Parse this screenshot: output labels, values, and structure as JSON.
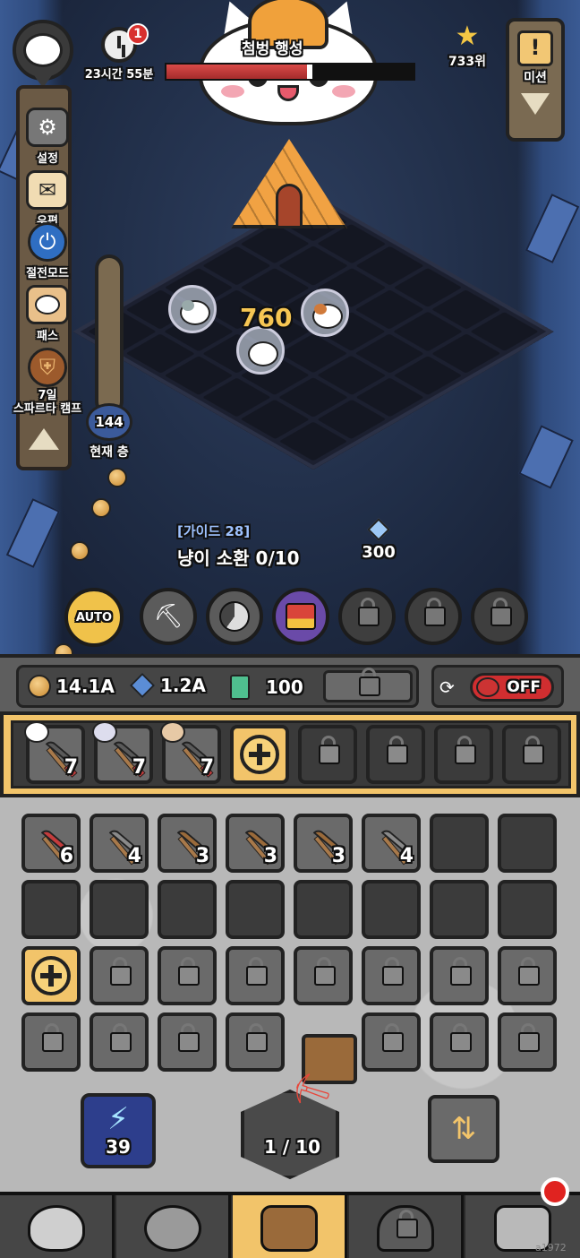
{
  "boss": {
    "name": "첨벙 행성",
    "hp_fraction": 0.59
  },
  "timer": {
    "badge_count": "1",
    "label": "23시간 55분"
  },
  "rank": {
    "label": "733위"
  },
  "mission": {
    "label": "미션",
    "icon": "!"
  },
  "sidebar": {
    "items": [
      {
        "label": "설정",
        "icon": "gear-icon"
      },
      {
        "label": "우편",
        "icon": "mail-icon"
      },
      {
        "label": "절전모드",
        "icon": "power-icon"
      },
      {
        "label": "패스",
        "icon": "pass-icon"
      },
      {
        "label": "7일\n스파르타 캠프",
        "line1": "7일",
        "line2": "스파르타 캠프",
        "icon": "spartan-helmet-icon"
      }
    ]
  },
  "depth": {
    "value": "144",
    "label": "현재 층"
  },
  "field": {
    "damage_text": "760"
  },
  "guide": {
    "title": "[가이드 28]",
    "task": "냥이 소환 0/10",
    "reward": "300"
  },
  "skills": {
    "auto_label": "AUTO"
  },
  "resources": {
    "gold": "14.1A",
    "gem": "1.2A",
    "ticket": "100",
    "auto_sell_state": "OFF"
  },
  "equip_slots": [
    {
      "level": "7",
      "has_cat": true
    },
    {
      "level": "7",
      "has_cat": true
    },
    {
      "level": "7",
      "has_cat": true
    }
  ],
  "inventory": {
    "row1": [
      "6",
      "4",
      "3",
      "3",
      "3",
      "4"
    ],
    "pick_colors": [
      "#c43c3c",
      "#8a8a8a",
      "#9a6a3a",
      "#9a6a3a",
      "#9a6a3a",
      "#8a8a8a"
    ]
  },
  "forge": {
    "boost_count": "39",
    "progress": "1 / 10"
  },
  "colors": {
    "accent_gold": "#f2c46a",
    "hp_red": "#d94a48",
    "off_red": "#d02e30"
  },
  "watermark": "a1972"
}
